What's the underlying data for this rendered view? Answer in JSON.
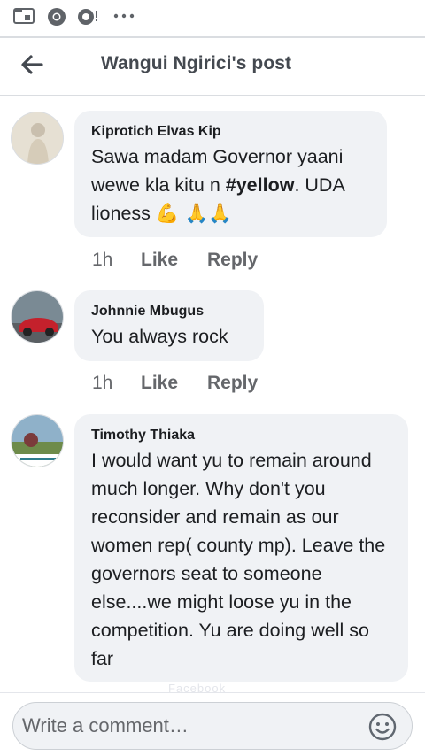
{
  "status_bar": {
    "icons": [
      "folder-icon",
      "chrome-icon",
      "vpn-icon",
      "more-dots-icon"
    ]
  },
  "header": {
    "title": "Wangui Ngirici's post",
    "back_icon": "arrow-left-icon"
  },
  "comments": [
    {
      "author": "Kiprotich Elvas Kip",
      "text_before": "Sawa madam Governor yaani wewe kla kitu n ",
      "hashtag": "#yellow",
      "text_after": ". UDA lioness ",
      "emoji": "💪 🙏🙏",
      "time": "1h",
      "like": "Like",
      "reply": "Reply"
    },
    {
      "author": "Johnnie Mbugus",
      "text": "You always rock",
      "time": "1h",
      "like": "Like",
      "reply": "Reply"
    },
    {
      "author": "Timothy Thiaka",
      "text": "I would want yu to remain around much longer. Why don't you reconsider and remain as our women rep( county mp). Leave the governors seat to someone else....we might loose yu in the competition. Yu are doing well so far"
    }
  ],
  "composer": {
    "placeholder": "Write a comment…",
    "emoji_icon": "smiley-icon"
  },
  "watermark": "Facebook",
  "colors": {
    "bubble": "#f0f2f5",
    "meta": "#65676b",
    "divider": "#dadde1"
  }
}
